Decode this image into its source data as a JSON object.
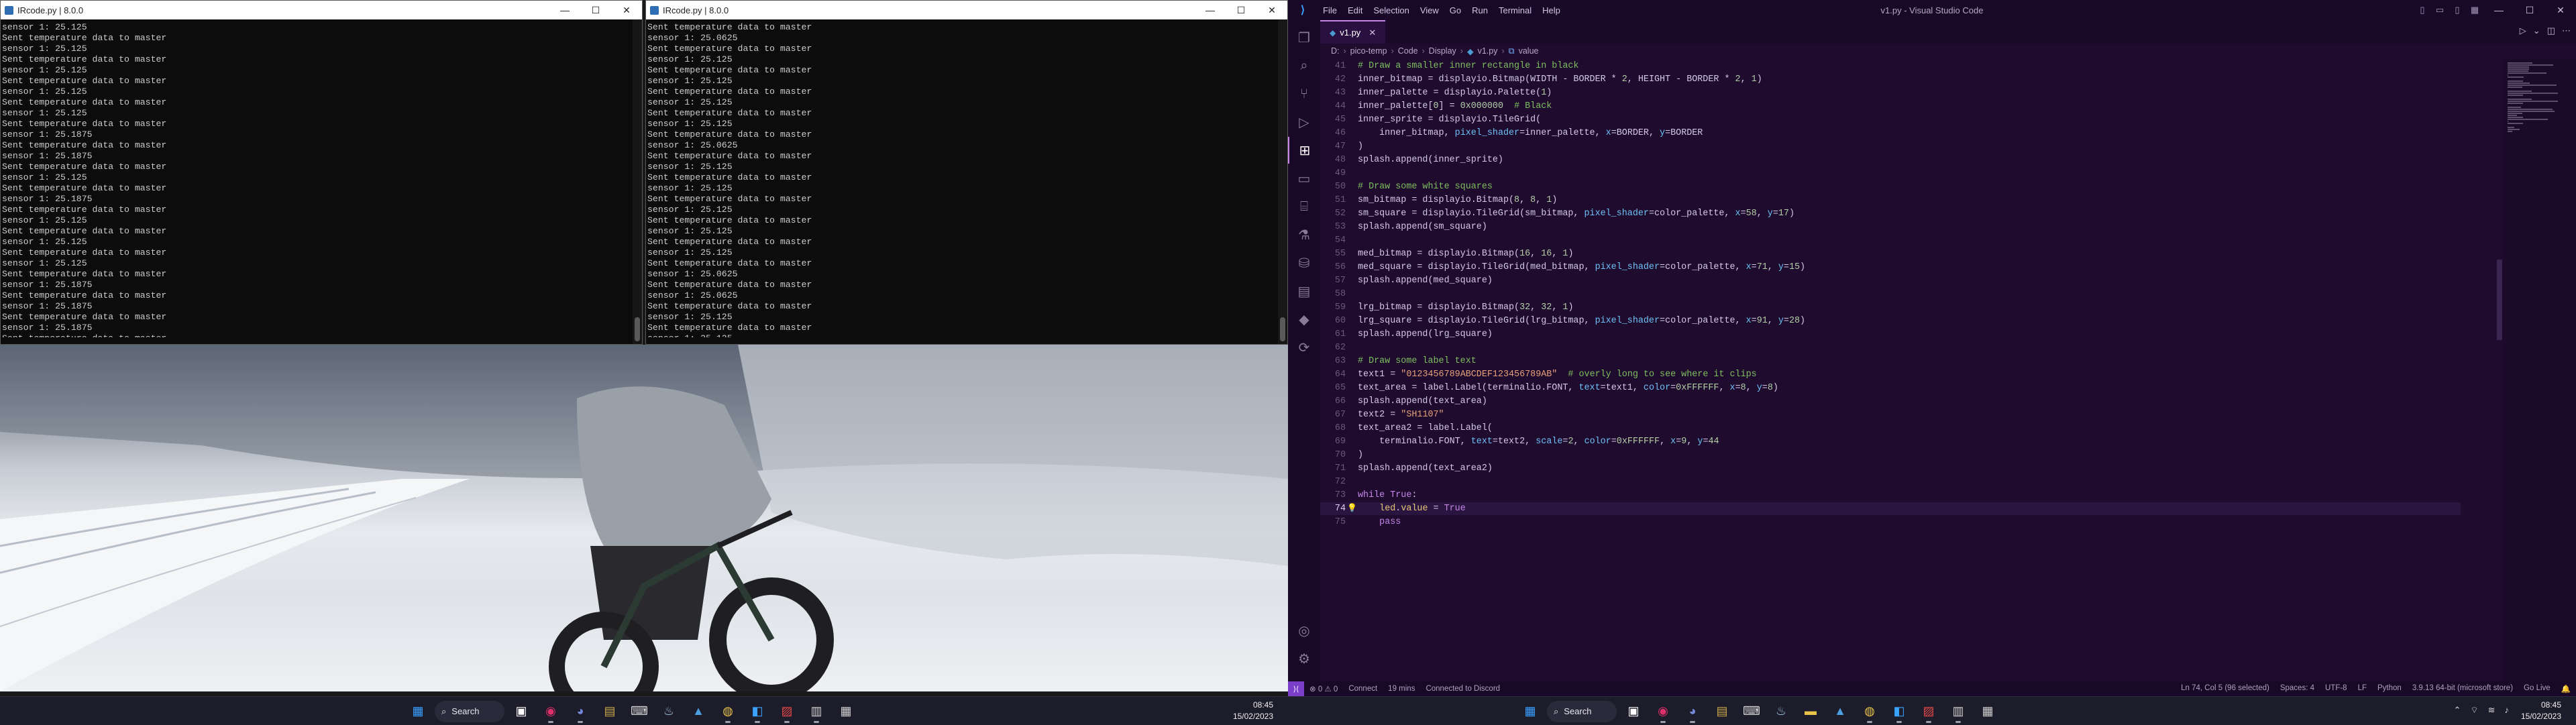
{
  "terminals": [
    {
      "title": "IRcode.py | 8.0.0",
      "lines": [
        "sensor 1: 25.125",
        "Sent temperature data to master",
        "sensor 1: 25.125",
        "Sent temperature data to master",
        "sensor 1: 25.125",
        "Sent temperature data to master",
        "sensor 1: 25.125",
        "Sent temperature data to master",
        "sensor 1: 25.125",
        "Sent temperature data to master",
        "sensor 1: 25.1875",
        "Sent temperature data to master",
        "sensor 1: 25.1875",
        "Sent temperature data to master",
        "sensor 1: 25.125",
        "Sent temperature data to master",
        "sensor 1: 25.1875",
        "Sent temperature data to master",
        "sensor 1: 25.125",
        "Sent temperature data to master",
        "sensor 1: 25.125",
        "Sent temperature data to master",
        "sensor 1: 25.125",
        "Sent temperature data to master",
        "sensor 1: 25.1875",
        "Sent temperature data to master",
        "sensor 1: 25.1875",
        "Sent temperature data to master",
        "sensor 1: 25.1875",
        "Sent temperature data to master",
        "sensor 1: 25.125"
      ]
    },
    {
      "title": "IRcode.py | 8.0.0",
      "lines": [
        "Sent temperature data to master",
        "sensor 1: 25.0625",
        "Sent temperature data to master",
        "sensor 1: 25.125",
        "Sent temperature data to master",
        "sensor 1: 25.125",
        "Sent temperature data to master",
        "sensor 1: 25.125",
        "Sent temperature data to master",
        "sensor 1: 25.125",
        "Sent temperature data to master",
        "sensor 1: 25.0625",
        "Sent temperature data to master",
        "sensor 1: 25.125",
        "Sent temperature data to master",
        "sensor 1: 25.125",
        "Sent temperature data to master",
        "sensor 1: 25.125",
        "Sent temperature data to master",
        "sensor 1: 25.125",
        "Sent temperature data to master",
        "sensor 1: 25.125",
        "Sent temperature data to master",
        "sensor 1: 25.0625",
        "Sent temperature data to master",
        "sensor 1: 25.0625",
        "Sent temperature data to master",
        "sensor 1: 25.125",
        "Sent temperature data to master",
        "sensor 1: 25.125",
        "Sent temperature data to master",
        "sensor 1: 25.125"
      ]
    }
  ],
  "window_controls": {
    "minimize": "—",
    "maximize": "☐",
    "close": "✕"
  },
  "vscode": {
    "menu": [
      "File",
      "Edit",
      "Selection",
      "View",
      "Go",
      "Run",
      "Terminal",
      "Help"
    ],
    "window_title": "v1.py - Visual Studio Code",
    "tab_label": "v1.py",
    "breadcrumb": [
      "D:",
      "pico-temp",
      "Code",
      "Display",
      "v1.py",
      "value"
    ],
    "code": [
      {
        "n": "41",
        "t": [
          [
            "cm",
            "# Draw a smaller inner rectangle in black"
          ]
        ]
      },
      {
        "n": "42",
        "t": [
          [
            "tx",
            "inner_bitmap = displayio.Bitmap(WIDTH - BORDER * "
          ],
          [
            "num",
            "2"
          ],
          [
            "tx",
            ", HEIGHT - BORDER * "
          ],
          [
            "num",
            "2"
          ],
          [
            "tx",
            ", "
          ],
          [
            "num",
            "1"
          ],
          [
            "tx",
            ")"
          ]
        ]
      },
      {
        "n": "43",
        "t": [
          [
            "tx",
            "inner_palette = displayio.Palette("
          ],
          [
            "num",
            "1"
          ],
          [
            "tx",
            ")"
          ]
        ]
      },
      {
        "n": "44",
        "t": [
          [
            "tx",
            "inner_palette["
          ],
          [
            "num",
            "0"
          ],
          [
            "tx",
            "] = "
          ],
          [
            "num",
            "0x000000"
          ],
          [
            "tx",
            "  "
          ],
          [
            "cm",
            "# Black"
          ]
        ]
      },
      {
        "n": "45",
        "t": [
          [
            "tx",
            "inner_sprite = displayio.TileGrid("
          ]
        ]
      },
      {
        "n": "46",
        "t": [
          [
            "tx",
            "    inner_bitmap, "
          ],
          [
            "pa",
            "pixel_shader"
          ],
          [
            "tx",
            "=inner_palette, "
          ],
          [
            "pa",
            "x"
          ],
          [
            "tx",
            "=BORDER, "
          ],
          [
            "pa",
            "y"
          ],
          [
            "tx",
            "=BORDER"
          ]
        ]
      },
      {
        "n": "47",
        "t": [
          [
            "tx",
            ")"
          ]
        ]
      },
      {
        "n": "48",
        "t": [
          [
            "tx",
            "splash.append(inner_sprite)"
          ]
        ]
      },
      {
        "n": "49",
        "t": []
      },
      {
        "n": "50",
        "t": [
          [
            "cm",
            "# Draw some white squares"
          ]
        ]
      },
      {
        "n": "51",
        "t": [
          [
            "tx",
            "sm_bitmap = displayio.Bitmap("
          ],
          [
            "num",
            "8"
          ],
          [
            "tx",
            ", "
          ],
          [
            "num",
            "8"
          ],
          [
            "tx",
            ", "
          ],
          [
            "num",
            "1"
          ],
          [
            "tx",
            ")"
          ]
        ]
      },
      {
        "n": "52",
        "t": [
          [
            "tx",
            "sm_square = displayio.TileGrid(sm_bitmap, "
          ],
          [
            "pa",
            "pixel_shader"
          ],
          [
            "tx",
            "=color_palette, "
          ],
          [
            "pa",
            "x"
          ],
          [
            "tx",
            "="
          ],
          [
            "num",
            "58"
          ],
          [
            "tx",
            ", "
          ],
          [
            "pa",
            "y"
          ],
          [
            "tx",
            "="
          ],
          [
            "num",
            "17"
          ],
          [
            "tx",
            ")"
          ]
        ]
      },
      {
        "n": "53",
        "t": [
          [
            "tx",
            "splash.append(sm_square)"
          ]
        ]
      },
      {
        "n": "54",
        "t": []
      },
      {
        "n": "55",
        "t": [
          [
            "tx",
            "med_bitmap = displayio.Bitmap("
          ],
          [
            "num",
            "16"
          ],
          [
            "tx",
            ", "
          ],
          [
            "num",
            "16"
          ],
          [
            "tx",
            ", "
          ],
          [
            "num",
            "1"
          ],
          [
            "tx",
            ")"
          ]
        ]
      },
      {
        "n": "56",
        "t": [
          [
            "tx",
            "med_square = displayio.TileGrid(med_bitmap, "
          ],
          [
            "pa",
            "pixel_shader"
          ],
          [
            "tx",
            "=color_palette, "
          ],
          [
            "pa",
            "x"
          ],
          [
            "tx",
            "="
          ],
          [
            "num",
            "71"
          ],
          [
            "tx",
            ", "
          ],
          [
            "pa",
            "y"
          ],
          [
            "tx",
            "="
          ],
          [
            "num",
            "15"
          ],
          [
            "tx",
            ")"
          ]
        ]
      },
      {
        "n": "57",
        "t": [
          [
            "tx",
            "splash.append(med_square)"
          ]
        ]
      },
      {
        "n": "58",
        "t": []
      },
      {
        "n": "59",
        "t": [
          [
            "tx",
            "lrg_bitmap = displayio.Bitmap("
          ],
          [
            "num",
            "32"
          ],
          [
            "tx",
            ", "
          ],
          [
            "num",
            "32"
          ],
          [
            "tx",
            ", "
          ],
          [
            "num",
            "1"
          ],
          [
            "tx",
            ")"
          ]
        ]
      },
      {
        "n": "60",
        "t": [
          [
            "tx",
            "lrg_square = displayio.TileGrid(lrg_bitmap, "
          ],
          [
            "pa",
            "pixel_shader"
          ],
          [
            "tx",
            "=color_palette, "
          ],
          [
            "pa",
            "x"
          ],
          [
            "tx",
            "="
          ],
          [
            "num",
            "91"
          ],
          [
            "tx",
            ", "
          ],
          [
            "pa",
            "y"
          ],
          [
            "tx",
            "="
          ],
          [
            "num",
            "28"
          ],
          [
            "tx",
            ")"
          ]
        ]
      },
      {
        "n": "61",
        "t": [
          [
            "tx",
            "splash.append(lrg_square)"
          ]
        ]
      },
      {
        "n": "62",
        "t": []
      },
      {
        "n": "63",
        "t": [
          [
            "cm",
            "# Draw some label text"
          ]
        ]
      },
      {
        "n": "64",
        "t": [
          [
            "tx",
            "text1 = "
          ],
          [
            "str",
            "\"0123456789ABCDEF123456789AB\""
          ],
          [
            "tx",
            "  "
          ],
          [
            "cm",
            "# overly long to see where it clips"
          ]
        ]
      },
      {
        "n": "65",
        "t": [
          [
            "tx",
            "text_area = label.Label(terminalio.FONT, "
          ],
          [
            "pa",
            "text"
          ],
          [
            "tx",
            "=text1, "
          ],
          [
            "pa",
            "color"
          ],
          [
            "tx",
            "="
          ],
          [
            "num",
            "0xFFFFFF"
          ],
          [
            "tx",
            ", "
          ],
          [
            "pa",
            "x"
          ],
          [
            "tx",
            "="
          ],
          [
            "num",
            "8"
          ],
          [
            "tx",
            ", "
          ],
          [
            "pa",
            "y"
          ],
          [
            "tx",
            "="
          ],
          [
            "num",
            "8"
          ],
          [
            "tx",
            ")"
          ]
        ]
      },
      {
        "n": "66",
        "t": [
          [
            "tx",
            "splash.append(text_area)"
          ]
        ]
      },
      {
        "n": "67",
        "t": [
          [
            "tx",
            "text2 = "
          ],
          [
            "str",
            "\"SH1107\""
          ]
        ]
      },
      {
        "n": "68",
        "t": [
          [
            "tx",
            "text_area2 = label.Label("
          ]
        ]
      },
      {
        "n": "69",
        "t": [
          [
            "tx",
            "    terminalio.FONT, "
          ],
          [
            "pa",
            "text"
          ],
          [
            "tx",
            "=text2, "
          ],
          [
            "pa",
            "scale"
          ],
          [
            "tx",
            "="
          ],
          [
            "num",
            "2"
          ],
          [
            "tx",
            ", "
          ],
          [
            "pa",
            "color"
          ],
          [
            "tx",
            "="
          ],
          [
            "num",
            "0xFFFFFF"
          ],
          [
            "tx",
            ", "
          ],
          [
            "pa",
            "x"
          ],
          [
            "tx",
            "="
          ],
          [
            "num",
            "9"
          ],
          [
            "tx",
            ", "
          ],
          [
            "pa",
            "y"
          ],
          [
            "tx",
            "="
          ],
          [
            "num",
            "44"
          ]
        ]
      },
      {
        "n": "70",
        "t": [
          [
            "tx",
            ")"
          ]
        ]
      },
      {
        "n": "71",
        "t": [
          [
            "tx",
            "splash.append(text_area2)"
          ]
        ]
      },
      {
        "n": "72",
        "t": []
      },
      {
        "n": "73",
        "t": [
          [
            "kw",
            "while"
          ],
          [
            "tx",
            " "
          ],
          [
            "kw",
            "True"
          ],
          [
            "tx",
            ":"
          ]
        ]
      },
      {
        "n": "74",
        "t": [
          [
            "tx",
            "    "
          ],
          [
            "id",
            "led"
          ],
          [
            "tx",
            "."
          ],
          [
            "id",
            "value"
          ],
          [
            "tx",
            " = "
          ],
          [
            "kw",
            "True"
          ]
        ]
      },
      {
        "n": "75",
        "t": [
          [
            "tx",
            "    "
          ],
          [
            "kw",
            "pass"
          ]
        ]
      }
    ],
    "current_line": "74",
    "statusbar_left": [
      "⊗ 0 ⚠ 0",
      "Connect",
      "19 mins",
      "Connected to Discord"
    ],
    "statusbar_right": [
      "Ln 74, Col 5 (96 selected)",
      "Spaces: 4",
      "UTF-8",
      "LF",
      "Python",
      "3.9.13 64-bit (microsoft store)",
      "Go Live"
    ]
  },
  "taskbar": {
    "search_label": "Search",
    "time": "08:45",
    "date": "15/02/2023"
  },
  "colors": {
    "vscode_bg": "#1e0b2e",
    "vscode_accent": "#c586e8",
    "terminal_bg": "#0c0c0c"
  }
}
